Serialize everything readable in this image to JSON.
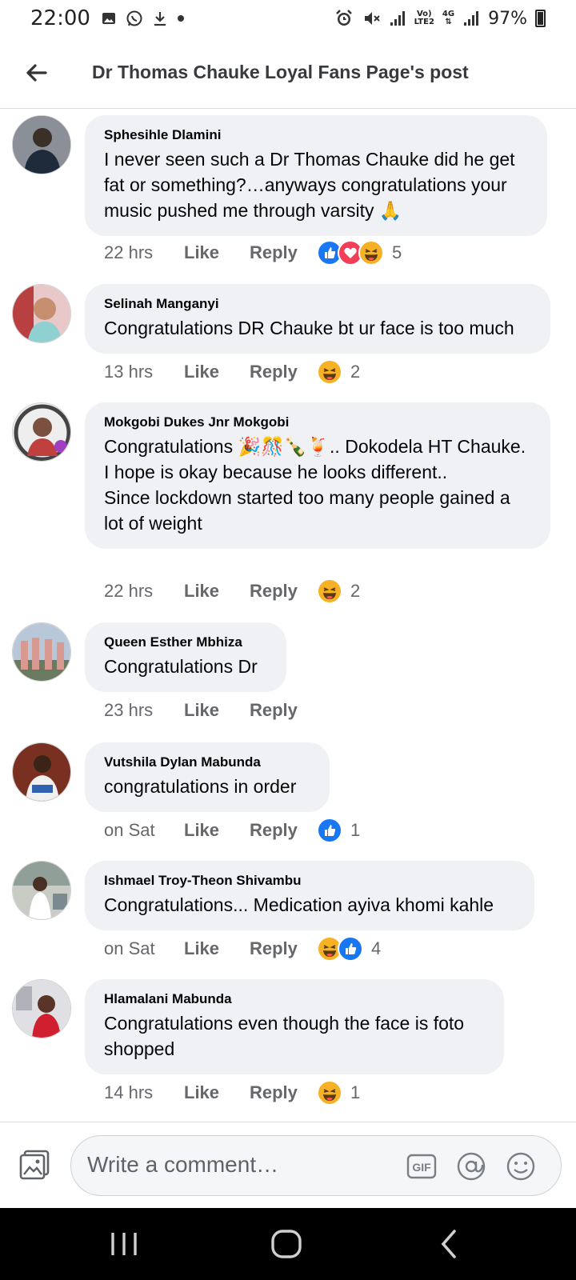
{
  "status_bar": {
    "time": "22:00",
    "left_icons": [
      "gallery-icon",
      "whatsapp-icon",
      "download-icon",
      "dot-icon"
    ],
    "network_top": "Vo)",
    "network_bottom": "LTE2",
    "network_type": "4G",
    "battery": "97%"
  },
  "header": {
    "title": "Dr Thomas Chauke Loyal Fans Page's post"
  },
  "comments": [
    {
      "author": "Sphesihle Dlamini",
      "text": "I never seen such a Dr Thomas Chauke did he get fat or something?…anyways congratulations your music pushed me through varsity 🙏",
      "time": "22 hrs",
      "like_label": "Like",
      "reply_label": "Reply",
      "reactions": [
        "like",
        "love",
        "haha"
      ],
      "reaction_count": "5",
      "avatar_color": "#5d6a7a"
    },
    {
      "author": "Selinah Manganyi",
      "text": "Congratulations DR Chauke bt ur face is too much",
      "time": "13 hrs",
      "like_label": "Like",
      "reply_label": "Reply",
      "reactions": [
        "haha"
      ],
      "reaction_count": "2",
      "avatar_color": "#c78a8a"
    },
    {
      "author": "Mokgobi Dukes Jnr Mokgobi",
      "text": "Congratulations 🎉🎊🍾🍹.. Dokodela HT Chauke.\nI hope is okay because he looks different..\nSince lockdown started too many people gained a lot of weight",
      "time": "22 hrs",
      "like_label": "Like",
      "reply_label": "Reply",
      "reactions": [
        "haha"
      ],
      "reaction_count": "2",
      "avatar_color": "#8a6a5a"
    },
    {
      "author": "Queen Esther Mbhiza",
      "text": "Congratulations Dr",
      "time": "23 hrs",
      "like_label": "Like",
      "reply_label": "Reply",
      "reactions": [],
      "reaction_count": "",
      "avatar_color": "#6a8aa8"
    },
    {
      "author": "Vutshila Dylan Mabunda",
      "text": "congratulations in order",
      "time": "on Sat",
      "like_label": "Like",
      "reply_label": "Reply",
      "reactions": [
        "like"
      ],
      "reaction_count": "1",
      "avatar_color": "#7a3a2a"
    },
    {
      "author": "Ishmael Troy-Theon Shivambu",
      "text": "Congratulations... Medication ayiva khomi kahle",
      "time": "on Sat",
      "like_label": "Like",
      "reply_label": "Reply",
      "reactions": [
        "haha",
        "like"
      ],
      "reaction_count": "4",
      "avatar_color": "#a8b0a0"
    },
    {
      "author": "Hlamalani Mabunda",
      "text": "Congratulations even though the face is foto shopped",
      "time": "14 hrs",
      "like_label": "Like",
      "reply_label": "Reply",
      "reactions": [
        "haha"
      ],
      "reaction_count": "1",
      "avatar_color": "#c0504a"
    }
  ],
  "composer": {
    "placeholder": "Write a comment…",
    "gif_label": "GIF"
  },
  "colors": {
    "bubble": "#eff1f4",
    "like_blue": "#1877f2",
    "love_red": "#f33e58",
    "haha_yellow": "#f7b125",
    "meta_gray": "#65676b"
  }
}
